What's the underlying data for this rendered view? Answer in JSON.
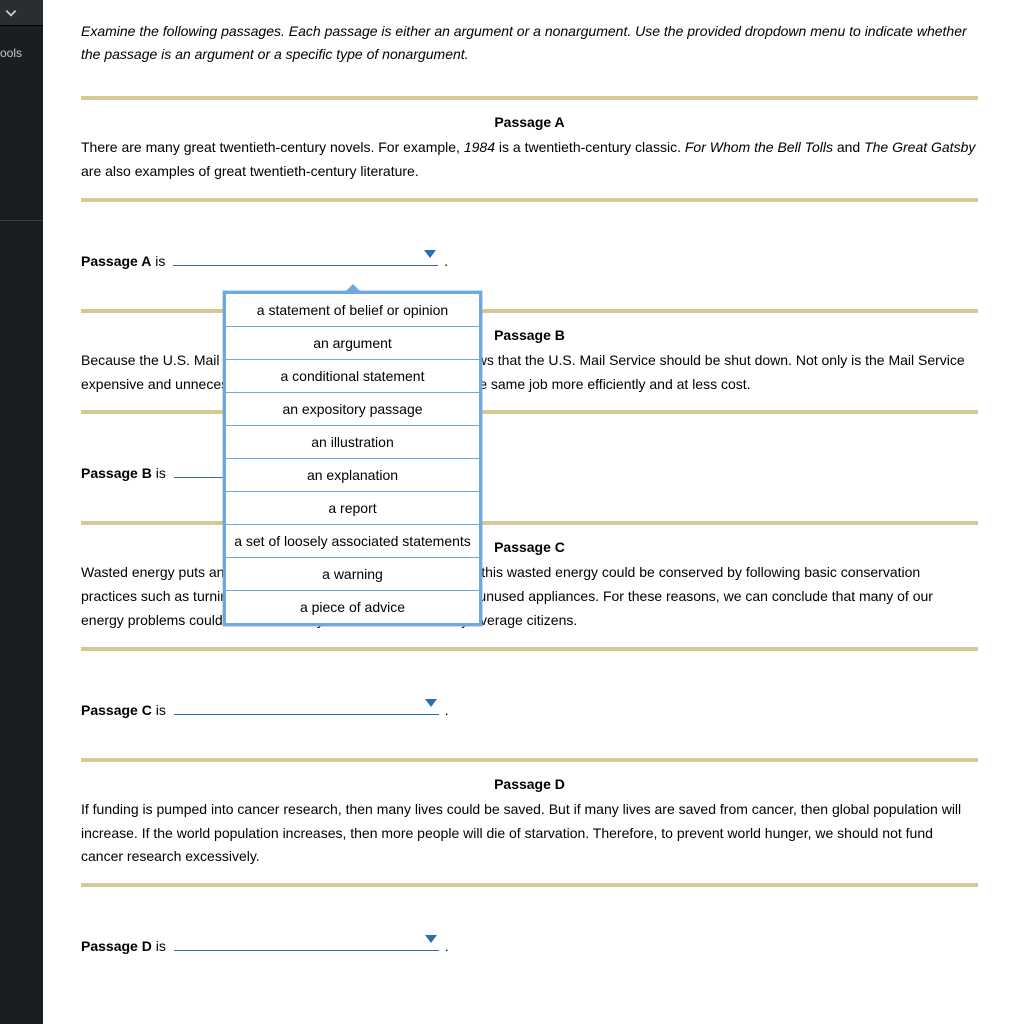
{
  "sidebar": {
    "chevron_label": "chevron",
    "tools_label": "ools"
  },
  "instructions": "Examine the following passages. Each passage is either an argument or a nonargument. Use the provided dropdown menu to indicate whether the passage is an argument or a specific type of nonargument.",
  "passages": {
    "a": {
      "heading": "Passage A",
      "body_pre": "There are many great twentieth-century novels. For example, ",
      "title1": "1984",
      "body_mid": " is a twentieth-century classic. ",
      "title2": "For Whom the Bell Tolls",
      "body_mid2": " and ",
      "title3": "The Great Gatsby",
      "body_post": " are also examples of great twentieth-century literature.",
      "answer_label": "Passage A",
      "answer_is": " is"
    },
    "b": {
      "heading": "Passage B",
      "body": "Because the U.S. Mail Service rarely, if ever, is profitable, it follows that the U.S. Mail Service should be shut down. Not only is the Mail Service expensive and unnecessary, but other shipping companies do the same job more efficiently and at less cost.",
      "answer_label": "Passage B",
      "answer_is": " is"
    },
    "c": {
      "heading": "Passage C",
      "body": "Wasted energy puts an extra burden on our power grid. Much of this wasted energy could be conserved by following basic conservation practices such as turning off unnecessary lights and unplugging unused appliances. For these reasons, we can conclude that many of our energy problems could be alleviated by conservation efforts by average citizens.",
      "answer_label": "Passage C",
      "answer_is": " is"
    },
    "d": {
      "heading": "Passage D",
      "body": "If funding is pumped into cancer research, then many lives could be saved. But if many lives are saved from cancer, then global population will increase. If the world population increases, then more people will die of starvation. Therefore, to prevent world hunger, we should not fund cancer research excessively.",
      "answer_label": "Passage D",
      "answer_is": " is"
    }
  },
  "dropdown_options": [
    "a statement of belief or opinion",
    "an argument",
    "a conditional statement",
    "an expository passage",
    "an illustration",
    "an explanation",
    "a report",
    "a set of loosely associated statements",
    "a warning",
    "a piece of advice"
  ],
  "period": "."
}
